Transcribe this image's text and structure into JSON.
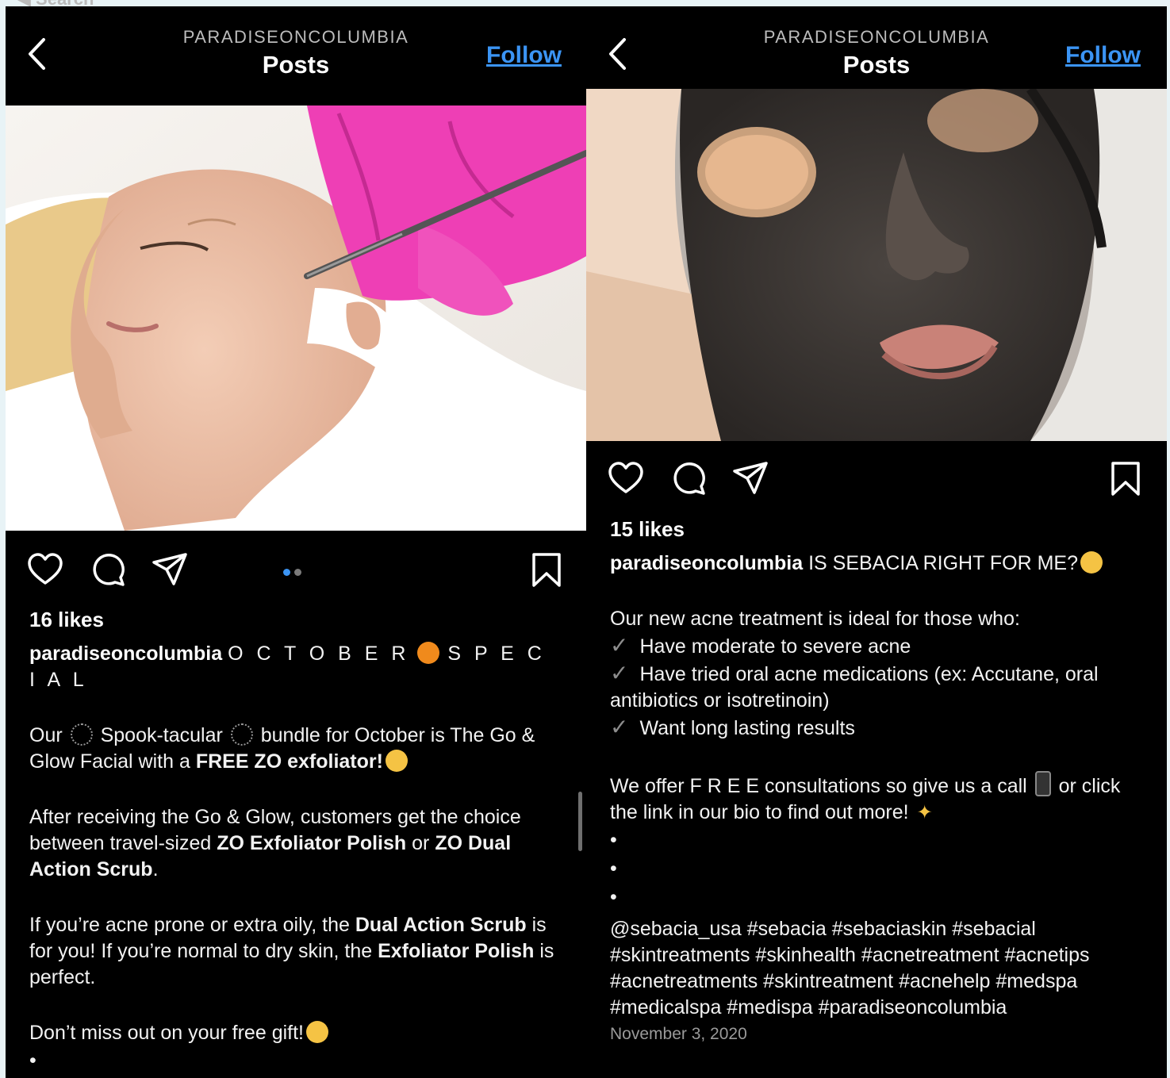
{
  "status_peek": "◀ Search",
  "left": {
    "header": {
      "username": "PARADISEONCOLUMBIA",
      "title": "Posts",
      "follow": "Follow"
    },
    "likes": "16 likes",
    "caption": {
      "username": "paradiseoncolumbia",
      "headline_a": "O C T O B E R",
      "headline_b": "S P E C I A L",
      "p1_a": "Our",
      "p1_b": "Spook-tacular",
      "p1_c": "bundle for October is The Go & Glow Facial with a",
      "p1_bold": "FREE ZO exfoliator!",
      "p2_a": "After receiving the Go & Glow, customers get the choice between travel-sized",
      "p2_bold1": "ZO Exfoliator Polish",
      "p2_b": "or",
      "p2_bold2": "ZO Dual Action Scrub",
      "p2_c": ".",
      "p3_a": "If you’re acne prone or extra oily, the",
      "p3_bold1": "Dual Action Scrub",
      "p3_b": "is for you! If you’re normal to dry skin, the",
      "p3_bold2": "Exfoliator Polish",
      "p3_c": "is perfect.",
      "p4": "Don’t miss out on your free gift!",
      "bullet": "•"
    }
  },
  "right": {
    "header": {
      "username": "PARADISEONCOLUMBIA",
      "title": "Posts",
      "follow": "Follow"
    },
    "likes": "15 likes",
    "caption": {
      "username": "paradiseoncolumbia",
      "headline": "IS SEBACIA RIGHT FOR ME?",
      "intro": "Our new acne treatment is ideal for those who:",
      "check_mark": "✓",
      "checks": [
        "Have moderate to severe acne",
        "Have tried oral acne medications (ex: Accutane, oral antibiotics or isotretinoin)",
        "Want long lasting results"
      ],
      "offer_a": "We offer F R E E consultations so give us a call",
      "offer_b": "or click the link in our bio to find out more!",
      "bullet": "•",
      "hashtags": "@sebacia_usa #sebacia #sebaciaskin #sebacial #skintreatments #skinhealth #acnetreatment #acnetips #acnetreatments #skintreatment #acnehelp #medspa #medicalspa #medispa #paradiseoncolumbia",
      "date": "November 3, 2020"
    }
  },
  "colors": {
    "follow": "#3b94f4",
    "background": "#000000",
    "dot_active": "#3b94f4",
    "dot_inactive": "#7a7a7a"
  },
  "icons": [
    "chevron-left-icon",
    "heart-icon",
    "comment-icon",
    "share-icon",
    "bookmark-icon",
    "pumpkin-emoji",
    "spiderweb-emoji",
    "scream-emoji",
    "star-struck-emoji",
    "thinking-emoji",
    "phone-emoji",
    "sparkles-emoji"
  ]
}
